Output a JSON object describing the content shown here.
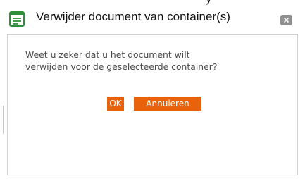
{
  "dialog": {
    "title": "Verwijder document van container(s)",
    "icon": "document-list-icon",
    "close_icon": "close-icon",
    "message_line1": "Weet u zeker dat u het document wilt",
    "message_line2": "verwijden voor de geselecteerde container?",
    "ok_label": "OK",
    "cancel_label": "Annuleren"
  },
  "colors": {
    "accent_button": "#e8620c",
    "icon_green": "#2f8f3a",
    "close_gray": "#8f8f8f"
  }
}
